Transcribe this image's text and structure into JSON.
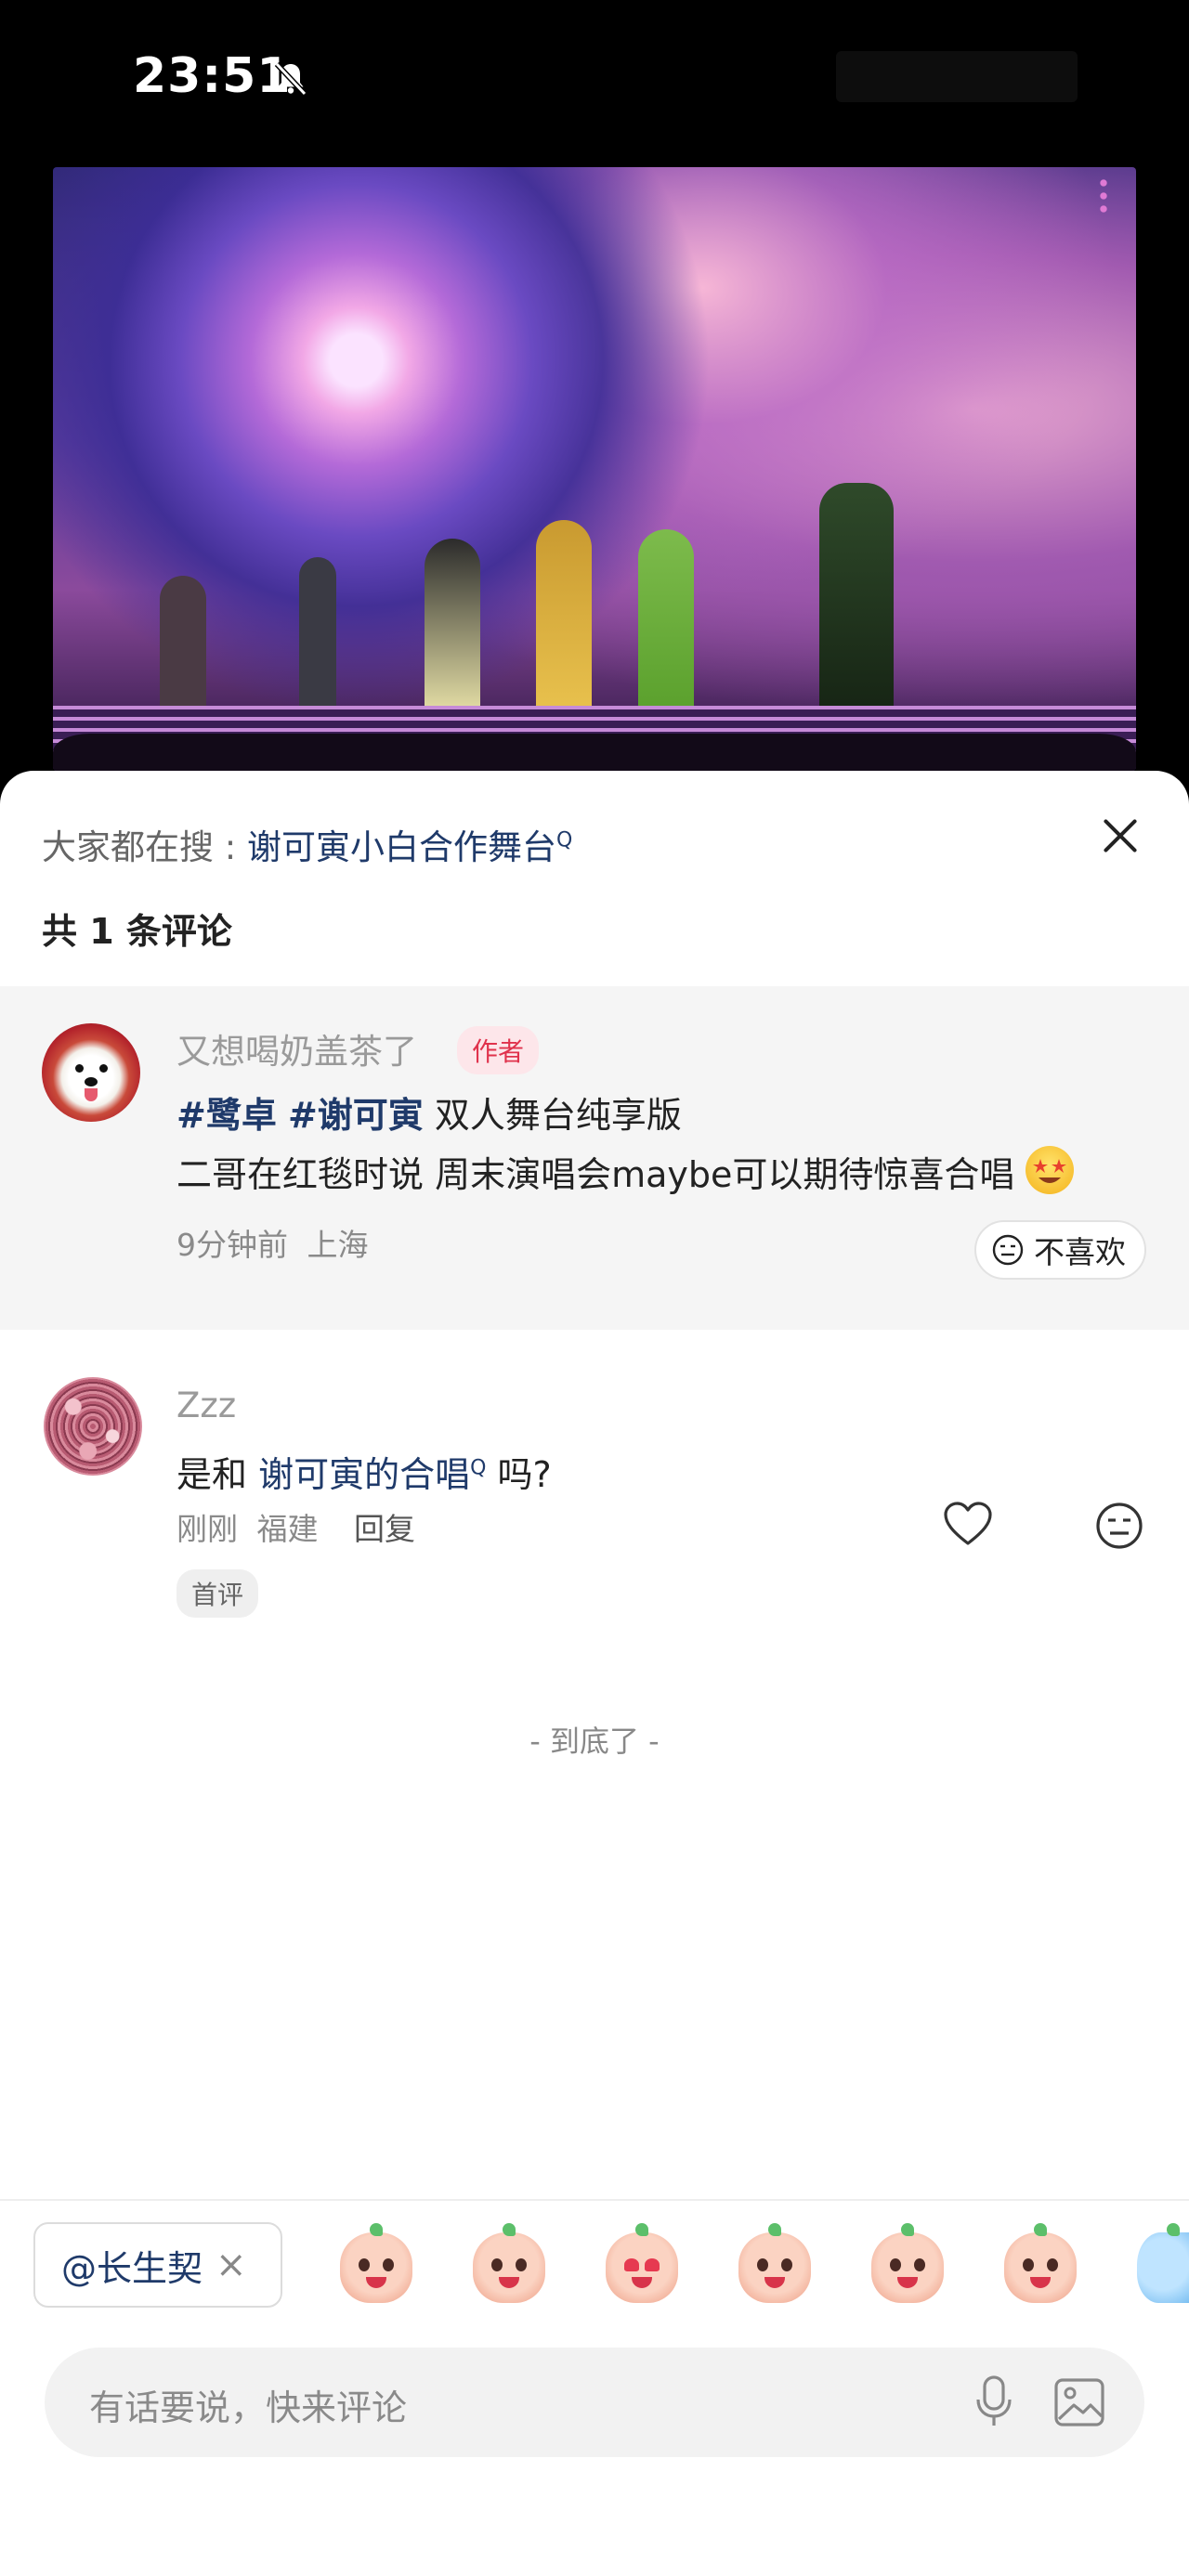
{
  "status_bar": {
    "time": "23:51",
    "icons": [
      "bell-muted-icon"
    ]
  },
  "video": {
    "description_icon": "concert-video"
  },
  "comments_sheet": {
    "search_hint": {
      "prefix": "大家都在搜 : ",
      "keyword": "谢可寅小白合作舞台",
      "search_marker": "Q"
    },
    "comment_count": "共 1 条评论",
    "pinned_comment": {
      "username": "又想喝奶盖茶了",
      "badge": "作者",
      "line1_tags": [
        "#鹭卓",
        "#谢可寅"
      ],
      "line1_text": " 双人舞台纯享版",
      "line2_text": "二哥在红毯时说 周末演唱会maybe可以期待惊喜合唱",
      "time": "9分钟前",
      "location": "上海",
      "dislike_label": "不喜欢"
    },
    "comment": {
      "username": "Zzz",
      "text_before": "是和 ",
      "link_text": "谢可寅的合唱",
      "link_marker": "Q",
      "text_after": " 吗?",
      "time": "刚刚",
      "location": "福建",
      "reply_label": "回复",
      "badge": "首评"
    },
    "end_text": "- 到底了 -"
  },
  "composer": {
    "mention_chip": "@长生契",
    "mention_remove": "×",
    "placeholder": "有话要说，快来评论",
    "stickers": [
      "happy",
      "pleading",
      "heart-eyes",
      "kiss",
      "shy",
      "cover-mouth",
      "blue-partial"
    ]
  },
  "colors": {
    "link": "#1f3a6a",
    "author_badge": "#e0324c",
    "pinned_bg": "#f5f5f5"
  }
}
